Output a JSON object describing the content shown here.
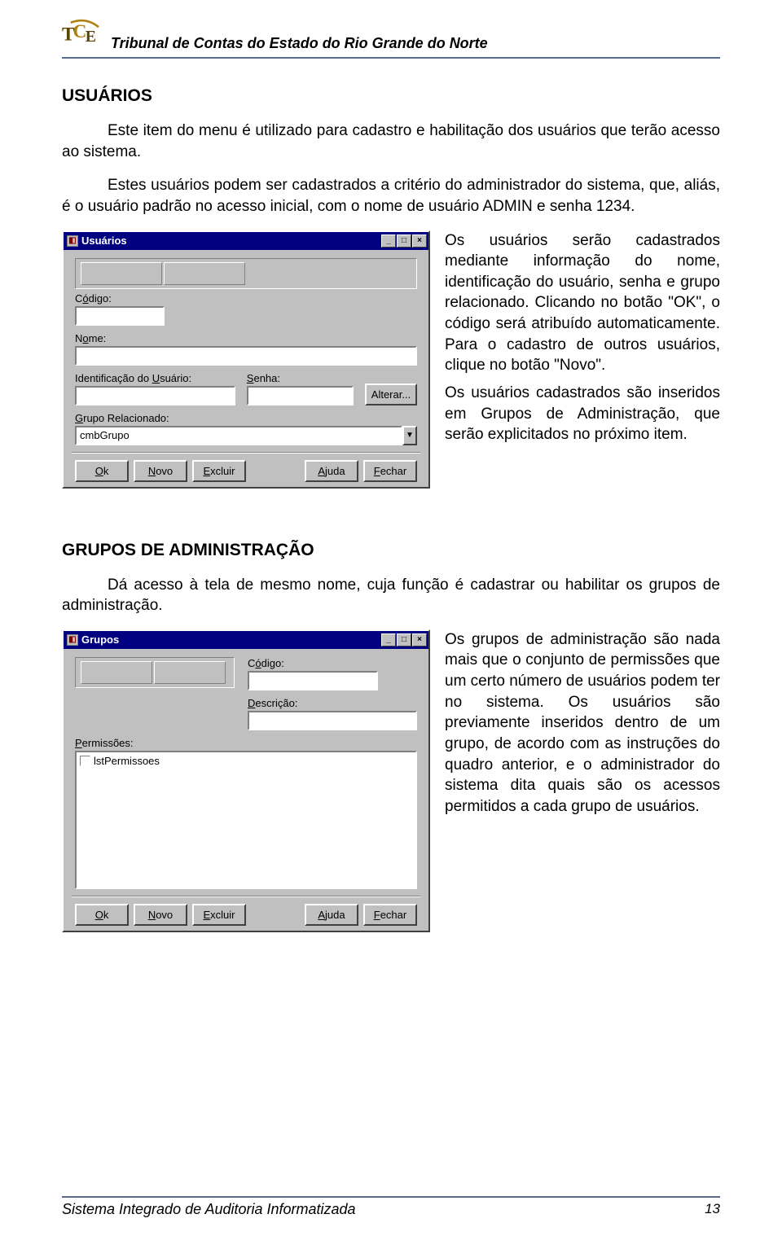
{
  "header": {
    "org": "Tribunal de Contas do Estado do Rio Grande do Norte"
  },
  "section1": {
    "title": "USUÁRIOS",
    "p1": "Este item do menu é utilizado para cadastro e habilitação dos usuários que terão acesso ao sistema.",
    "p2": "Estes usuários podem ser cadastrados a critério do administrador do sistema, que, aliás, é o usuário padrão no acesso inicial, com o nome de usuário ADMIN e senha 1234.",
    "side_p1": "Os usuários serão cadastrados mediante informação do nome, identificação do usuário, senha e grupo relacionado. Clicando no botão \"OK\", o código será atribuído automaticamente. Para o cadastro de outros usuários, clique no botão \"Novo\".",
    "side_p2": "Os usuários cadastrados são inseridos em Grupos de Administração, que serão explicitados no próximo item."
  },
  "dlg_users": {
    "title": "Usuários",
    "lbl_codigo_pre": "C",
    "lbl_codigo_u": "ó",
    "lbl_codigo_post": "digo:",
    "lbl_nome_pre": "N",
    "lbl_nome_u": "o",
    "lbl_nome_post": "me:",
    "lbl_ident_pre": "Identificação do ",
    "lbl_ident_u": "U",
    "lbl_ident_post": "suário:",
    "lbl_senha_pre": "",
    "lbl_senha_u": "S",
    "lbl_senha_post": "enha:",
    "btn_alterar": "Alterar...",
    "lbl_grupo_pre": "",
    "lbl_grupo_u": "G",
    "lbl_grupo_post": "rupo Relacionado:",
    "combo_value": "cmbGrupo",
    "btn_ok_u": "O",
    "btn_ok_post": "k",
    "btn_novo_u": "N",
    "btn_novo_post": "ovo",
    "btn_excluir_u": "E",
    "btn_excluir_post": "xcluir",
    "btn_ajuda_u": "A",
    "btn_ajuda_post": "juda",
    "btn_fechar_u": "F",
    "btn_fechar_post": "echar"
  },
  "section2": {
    "title": "GRUPOS DE ADMINISTRAÇÃO",
    "p1": "Dá acesso à tela de mesmo nome, cuja função é cadastrar ou habilitar os grupos de administração.",
    "side_p1": "Os grupos de administração são nada mais que o conjunto de permissões que um certo número de usuários podem ter no sistema. Os usuários são previamente inseridos dentro de um grupo, de acordo com as instruções do quadro anterior, e o administrador do sistema dita quais são os acessos permitidos a cada grupo de usuários."
  },
  "dlg_groups": {
    "title": "Grupos",
    "lbl_codigo_pre": "C",
    "lbl_codigo_u": "ó",
    "lbl_codigo_post": "digo:",
    "lbl_descricao_pre": "",
    "lbl_descricao_u": "D",
    "lbl_descricao_post": "escrição:",
    "lbl_permissoes_pre": "",
    "lbl_permissoes_u": "P",
    "lbl_permissoes_post": "ermissões:",
    "list_item": "lstPermissoes",
    "btn_ok_u": "O",
    "btn_ok_post": "k",
    "btn_novo_u": "N",
    "btn_novo_post": "ovo",
    "btn_excluir_u": "E",
    "btn_excluir_post": "xcluir",
    "btn_ajuda_u": "A",
    "btn_ajuda_post": "juda",
    "btn_fechar_u": "F",
    "btn_fechar_post": "echar"
  },
  "footer": {
    "text": "Sistema Integrado de Auditoria Informatizada",
    "page": "13"
  }
}
